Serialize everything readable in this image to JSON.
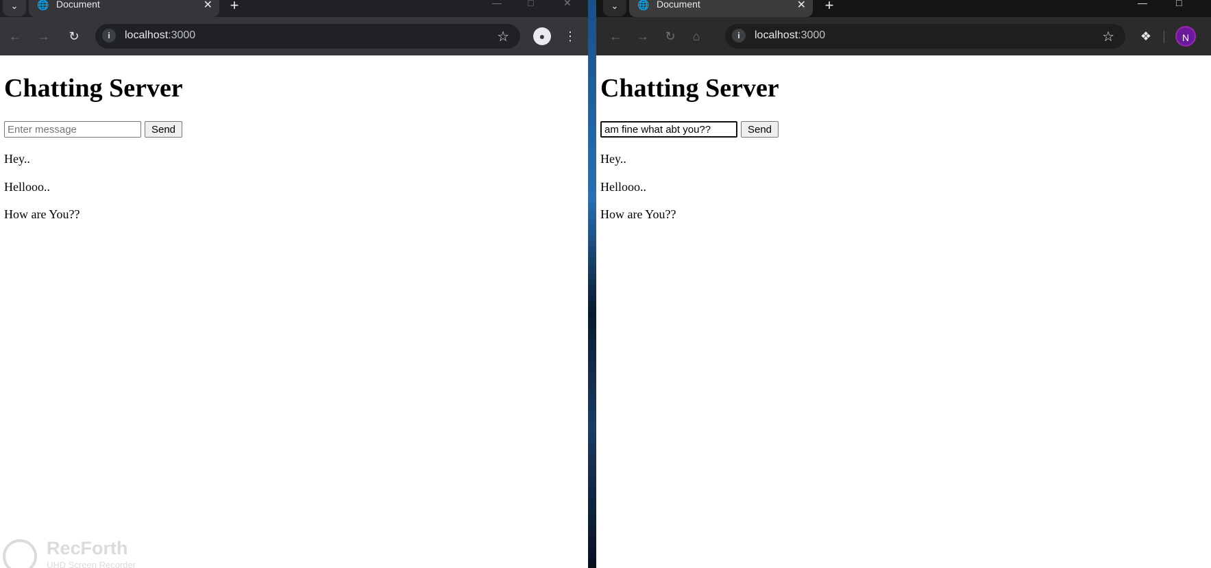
{
  "left_window": {
    "tab_title": "Document",
    "url_host": "localhost",
    "url_port": ":3000",
    "page": {
      "heading": "Chatting Server",
      "input_value": "",
      "input_placeholder": "Enter message",
      "send_label": "Send",
      "messages": [
        "Hey..",
        "Hellooo..",
        "How are You??"
      ]
    }
  },
  "right_window": {
    "tab_title": "Document",
    "url_host": "localhost",
    "url_port": ":3000",
    "avatar_initial": "N",
    "page": {
      "heading": "Chatting Server",
      "input_value": "am fine what abt you??",
      "send_label": "Send",
      "messages": [
        "Hey..",
        "Hellooo..",
        "How are You??"
      ]
    }
  },
  "watermark": {
    "title": "RecForth",
    "subtitle": "UHD Screen Recorder"
  },
  "colors": {
    "tab_strip": "#202124",
    "toolbar": "#35363a",
    "omnibox": "#202124",
    "profile_avatar": "#6a1b9a"
  }
}
